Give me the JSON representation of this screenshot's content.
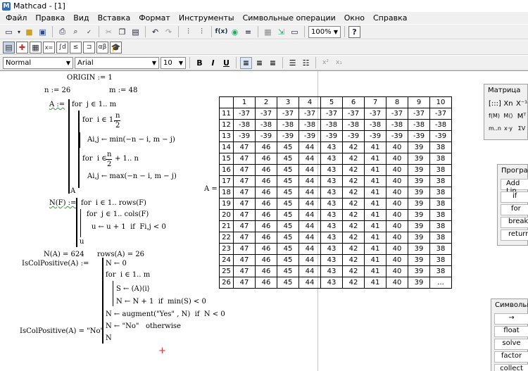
{
  "window": {
    "title": "Mathcad - [1]",
    "logo": "M"
  },
  "menu": [
    "Файл",
    "Правка",
    "Вид",
    "Вставка",
    "Формат",
    "Инструменты",
    "Символьные операции",
    "Окно",
    "Справка"
  ],
  "toolbar": {
    "zoom": "100%",
    "help_icon": "?"
  },
  "math_toolbar": [
    "calculator",
    "graph",
    "matrix",
    "evaluation",
    "calculus",
    "boolean",
    "programming",
    "greek",
    "symbolic"
  ],
  "format": {
    "style": "Normal",
    "font": "Arial",
    "size": "10",
    "bold": "B",
    "italic": "I",
    "underline": "U"
  },
  "worksheet": {
    "origin": "ORIGIN := 1",
    "n_def": "n := 26",
    "m_def": "m := 48",
    "A_def": "A :=",
    "A_line1": "for  j ∈ 1.. m",
    "A_line2": "for  i ∈ 1..",
    "A_frac1_num": "n",
    "A_frac1_den": "2",
    "A_line3": "Ai,j ← min(−n − i, m − j)",
    "A_line4": "for  i ∈",
    "A_frac2_num": "n",
    "A_frac2_den": "2",
    "A_line4b": "+ 1.. n",
    "A_line5": "Ai,j ← max(−n − i, m − j)",
    "A_return": "A",
    "N_def": "N(F) :=",
    "N_line1": "for  i ∈ 1.. rows(F)",
    "N_line2": "for  j ∈ 1.. cols(F)",
    "N_line3": "u ← u + 1  if  Fi,j < 0",
    "N_return": "u",
    "N_result": "N(A) = 624",
    "rows_result": "rows(A) = 26",
    "ICP_def": "IsColPositive(A) :=",
    "ICP_line1": "N ← 0",
    "ICP_line2": "for  i ∈ 1.. m",
    "ICP_line3": "S ← (A)⟨i⟩",
    "ICP_line4": "N ← N + 1  if  min(S) < 0",
    "ICP_line5": "N ← augment(\"Yes\" , N)  if  N < 0",
    "ICP_line6": "N ← \"No\"   otherwise",
    "ICP_return": "N",
    "ICP_result": "IsColPositive(A) = \"No\"",
    "A_label": "A ="
  },
  "result_table": {
    "col_headers": [
      "1",
      "2",
      "3",
      "4",
      "5",
      "6",
      "7",
      "8",
      "9",
      "10"
    ],
    "rows": [
      {
        "idx": "11",
        "vals": [
          "-37",
          "-37",
          "-37",
          "-37",
          "-37",
          "-37",
          "-37",
          "-37",
          "-37",
          "-37"
        ]
      },
      {
        "idx": "12",
        "vals": [
          "-38",
          "-38",
          "-38",
          "-38",
          "-38",
          "-38",
          "-38",
          "-38",
          "-38",
          "-38"
        ]
      },
      {
        "idx": "13",
        "vals": [
          "-39",
          "-39",
          "-39",
          "-39",
          "-39",
          "-39",
          "-39",
          "-39",
          "-39",
          "-39"
        ]
      },
      {
        "idx": "14",
        "vals": [
          "47",
          "46",
          "45",
          "44",
          "43",
          "42",
          "41",
          "40",
          "39",
          "38"
        ]
      },
      {
        "idx": "15",
        "vals": [
          "47",
          "46",
          "45",
          "44",
          "43",
          "42",
          "41",
          "40",
          "39",
          "38"
        ]
      },
      {
        "idx": "16",
        "vals": [
          "47",
          "46",
          "45",
          "44",
          "43",
          "42",
          "41",
          "40",
          "39",
          "38"
        ]
      },
      {
        "idx": "17",
        "vals": [
          "47",
          "46",
          "45",
          "44",
          "43",
          "42",
          "41",
          "40",
          "39",
          "38"
        ]
      },
      {
        "idx": "18",
        "vals": [
          "47",
          "46",
          "45",
          "44",
          "43",
          "42",
          "41",
          "40",
          "39",
          "38"
        ]
      },
      {
        "idx": "19",
        "vals": [
          "47",
          "46",
          "45",
          "44",
          "43",
          "42",
          "41",
          "40",
          "39",
          "38"
        ]
      },
      {
        "idx": "20",
        "vals": [
          "47",
          "46",
          "45",
          "44",
          "43",
          "42",
          "41",
          "40",
          "39",
          "38"
        ]
      },
      {
        "idx": "21",
        "vals": [
          "47",
          "46",
          "45",
          "44",
          "43",
          "42",
          "41",
          "40",
          "39",
          "38"
        ]
      },
      {
        "idx": "22",
        "vals": [
          "47",
          "46",
          "45",
          "44",
          "43",
          "42",
          "41",
          "40",
          "39",
          "38"
        ]
      },
      {
        "idx": "23",
        "vals": [
          "47",
          "46",
          "45",
          "44",
          "43",
          "42",
          "41",
          "40",
          "39",
          "38"
        ]
      },
      {
        "idx": "24",
        "vals": [
          "47",
          "46",
          "45",
          "44",
          "43",
          "42",
          "41",
          "40",
          "39",
          "38"
        ]
      },
      {
        "idx": "25",
        "vals": [
          "47",
          "46",
          "45",
          "44",
          "43",
          "42",
          "41",
          "40",
          "39",
          "38"
        ]
      },
      {
        "idx": "26",
        "vals": [
          "47",
          "46",
          "45",
          "44",
          "43",
          "42",
          "41",
          "40",
          "39",
          "..."
        ]
      }
    ]
  },
  "panels": {
    "matrix": {
      "title": "Матрица",
      "buttons": [
        "[:::]",
        "Xn",
        "X⁻¹",
        "f(M)",
        "M⟨⟩",
        "Mᵀ",
        "m..n",
        "x·y",
        "ΣV"
      ]
    },
    "programming": {
      "title": "Програм",
      "buttons": [
        "Add Lin",
        "if",
        "for",
        "break",
        "return"
      ]
    },
    "symbolic": {
      "title": "Символьны",
      "buttons": [
        "→",
        "float",
        "solve",
        "factor",
        "collect"
      ]
    }
  }
}
